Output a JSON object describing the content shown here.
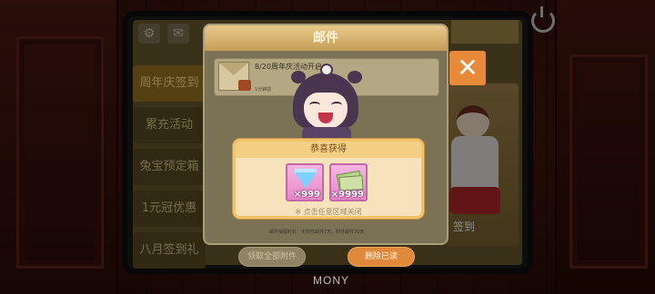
{
  "top_bar": {
    "settings_icon": "gear-icon",
    "mail_icon": "envelope-icon",
    "power_icon": "power-icon",
    "right_tab_label": ""
  },
  "side_menu": {
    "items": [
      {
        "label": "周年庆签到",
        "active": true
      },
      {
        "label": "累充活动",
        "active": false
      },
      {
        "label": "兔宝预定箱",
        "active": false
      },
      {
        "label": "1元冠优惠",
        "active": false
      },
      {
        "label": "八月签到礼",
        "active": false
      }
    ]
  },
  "promo": {
    "sign_label": "签到"
  },
  "mail_dialog": {
    "title": "邮件",
    "mail_item": {
      "subject": "8/20周年庆活动开启",
      "time": "1分钟前"
    },
    "footer_note": "邮件保留时长：无附件邮件7天，附件邮件30天",
    "collect_all_label": "领取全部附件",
    "delete_read_label": "删除已读"
  },
  "reward_popup": {
    "title": "恭喜获得",
    "items": [
      {
        "type": "diamond",
        "quantity": "×999"
      },
      {
        "type": "cash",
        "quantity": "×9999"
      }
    ],
    "hint": "※ 点击任意区域关闭"
  },
  "brand": "MONY",
  "colors": {
    "dialog_header": "#e8c98a",
    "close_button": "#e88a3a",
    "delete_button": "#e0893a",
    "reward_border": "#f2c46a"
  }
}
